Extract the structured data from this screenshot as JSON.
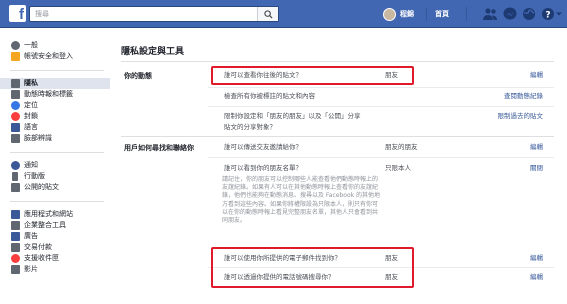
{
  "topbar": {
    "logo": "f",
    "search_placeholder": "搜尋",
    "profile_name": "程錦",
    "home_label": "首頁",
    "icons": [
      "friends-icon",
      "messenger-icon",
      "globe-icon",
      "help-icon",
      "dropdown-icon"
    ]
  },
  "sidebar": {
    "groups": [
      [
        {
          "label": "一般",
          "icon": "gear-icon",
          "color": "#606770"
        },
        {
          "label": "帳號安全和登入",
          "icon": "shield-icon",
          "color": "#f5a623"
        }
      ],
      [
        {
          "label": "隱私",
          "icon": "lock-icon",
          "color": "#606770",
          "active": true
        },
        {
          "label": "動態時報和標籤",
          "icon": "timeline-icon",
          "color": "#606770"
        },
        {
          "label": "定位",
          "icon": "location-icon",
          "color": "#3578e5"
        },
        {
          "label": "封鎖",
          "icon": "block-icon",
          "color": "#fa3e3e"
        },
        {
          "label": "語言",
          "icon": "language-icon",
          "color": "#3b5998"
        },
        {
          "label": "臉部辨識",
          "icon": "face-icon",
          "color": "#606770"
        }
      ],
      [
        {
          "label": "通知",
          "icon": "globe-icon",
          "color": "#3b5998"
        },
        {
          "label": "行動版",
          "icon": "mobile-icon",
          "color": "#606770"
        },
        {
          "label": "公開的貼文",
          "icon": "rss-icon",
          "color": "#606770"
        }
      ],
      [
        {
          "label": "應用程式和網站",
          "icon": "apps-icon",
          "color": "#3b5998"
        },
        {
          "label": "企業整合工具",
          "icon": "business-icon",
          "color": "#606770"
        },
        {
          "label": "廣告",
          "icon": "ads-icon",
          "color": "#3b5998"
        },
        {
          "label": "交易付款",
          "icon": "payment-icon",
          "color": "#606770"
        },
        {
          "label": "支援收件匣",
          "icon": "support-icon",
          "color": "#fa3e3e"
        },
        {
          "label": "影片",
          "icon": "video-icon",
          "color": "#606770"
        }
      ]
    ]
  },
  "main": {
    "title": "隱私設定與工具",
    "section1_label": "你的動態",
    "section1_rows": [
      {
        "question": "誰可以查看你往後的貼文？",
        "value": "朋友",
        "action": "編輯"
      },
      {
        "question": "檢查所有你被標註的貼文和內容",
        "value": "",
        "action": "查閱動態紀錄"
      },
      {
        "question": "限制你設定和「朋友的朋友」以及「公開」分享\n貼文的分享對象？",
        "value": "",
        "action": "限制過去的貼文"
      }
    ],
    "section2_label": "用戶如何尋找和聯絡你",
    "section2_rows": [
      {
        "question": "誰可以傳送交友邀請給你？",
        "value": "朋友的朋友",
        "action": "編輯"
      },
      {
        "question": "誰可以看到你的朋友名單？",
        "value": "只限本人",
        "action": "關閉"
      },
      {
        "question": "誰可以使用你所提供的電子郵件找到你？",
        "value": "朋友",
        "action": "編輯"
      },
      {
        "question": "誰可以透過你提供的電話號碼搜尋你？",
        "value": "朋友",
        "action": "編輯"
      }
    ],
    "friendlist_desc": "請記住，你的朋友可以控制哪些人能查看他們動態時報上的友誼紀錄。如果有人可以在其他動態時報上查看你的友誼紀錄，他們也能夠在動態消息、搜尋以及 Facebook 的其他地方看到這些內容。如果你將權限設為只限本人，則只有你可以在你的動態時報上看見完整朋友名單，其他人只會看到共同朋友。",
    "accent_link": "#365899",
    "highlight": "#e0192b"
  }
}
